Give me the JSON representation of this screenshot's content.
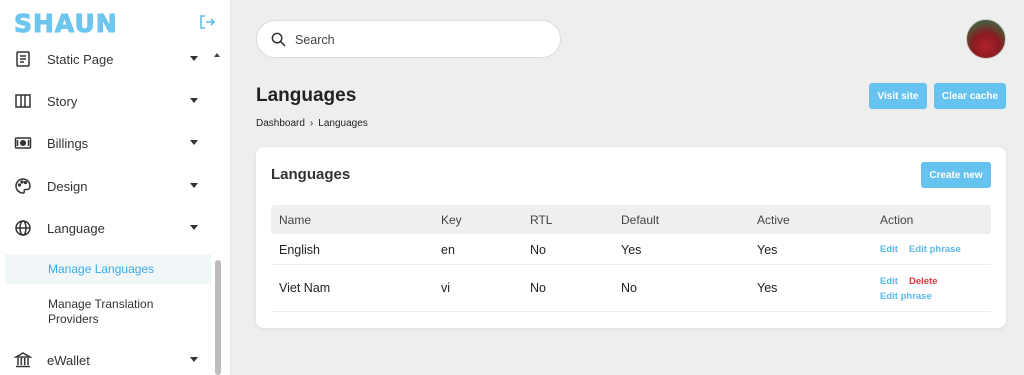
{
  "sidebar": {
    "logo": "SHAUN",
    "items": [
      {
        "label": "Static Page",
        "icon": "document-icon"
      },
      {
        "label": "Story",
        "icon": "columns-icon"
      },
      {
        "label": "Billings",
        "icon": "money-icon"
      },
      {
        "label": "Design",
        "icon": "palette-icon"
      },
      {
        "label": "Language",
        "icon": "globe-icon"
      },
      {
        "label": "eWallet",
        "icon": "bank-icon"
      }
    ],
    "sub_items": [
      {
        "label": "Manage Languages",
        "active": true
      },
      {
        "label": "Manage Translation Providers",
        "active": false
      }
    ]
  },
  "search": {
    "placeholder": "Search"
  },
  "header": {
    "title": "Languages",
    "breadcrumb": [
      "Dashboard",
      "Languages"
    ],
    "visit_site": "Visit site",
    "clear_cache": "Clear cache"
  },
  "card": {
    "title": "Languages",
    "create_new": "Create new",
    "columns": [
      "Name",
      "Key",
      "RTL",
      "Default",
      "Active",
      "Action"
    ],
    "rows": [
      {
        "name": "English",
        "key": "en",
        "rtl": "No",
        "default": "Yes",
        "active": "Yes",
        "actions": [
          "Edit",
          "Edit phrase"
        ]
      },
      {
        "name": "Viet Nam",
        "key": "vi",
        "rtl": "No",
        "default": "No",
        "active": "Yes",
        "actions": [
          "Edit",
          "Delete",
          "Edit phrase"
        ]
      }
    ]
  },
  "colors": {
    "accent": "#66c3ef",
    "link": "#5bb8ea",
    "danger": "#e0333b",
    "active_bg": "#f1f6f9"
  }
}
